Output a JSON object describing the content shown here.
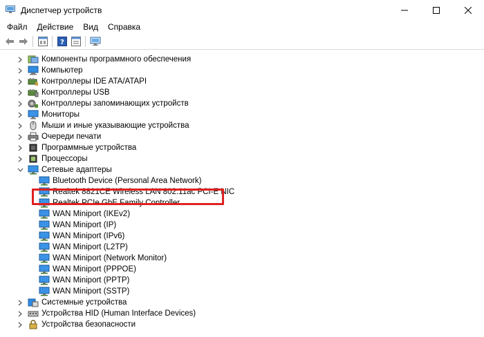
{
  "window": {
    "title": "Диспетчер устройств"
  },
  "menu": {
    "items": [
      {
        "label": "Файл"
      },
      {
        "label": "Действие"
      },
      {
        "label": "Вид"
      },
      {
        "label": "Справка"
      }
    ]
  },
  "toolbar": {
    "buttons": [
      "back-icon",
      "forward-icon",
      "properties-icon",
      "help-icon",
      "view-icon",
      "monitor-scan-icon"
    ]
  },
  "tree": {
    "categories_top": [
      {
        "label": "Компоненты программного обеспечения",
        "icon": "software-components-icon"
      },
      {
        "label": "Компьютер",
        "icon": "computer-icon"
      },
      {
        "label": "Контроллеры IDE ATA/ATAPI",
        "icon": "ide-controller-icon"
      },
      {
        "label": "Контроллеры USB",
        "icon": "usb-controller-icon"
      },
      {
        "label": "Контроллеры запоминающих устройств",
        "icon": "storage-controller-icon"
      },
      {
        "label": "Мониторы",
        "icon": "monitor-icon"
      },
      {
        "label": "Мыши и иные указывающие устройства",
        "icon": "mouse-icon"
      },
      {
        "label": "Очереди печати",
        "icon": "printer-icon"
      },
      {
        "label": "Программные устройства",
        "icon": "software-device-icon"
      },
      {
        "label": "Процессоры",
        "icon": "processor-icon"
      }
    ],
    "network": {
      "label": "Сетевые адаптеры",
      "icon": "network-adapter-icon",
      "children": [
        {
          "label": "Bluetooth Device (Personal Area Network)"
        },
        {
          "label": "Realtek 8821CE Wireless LAN 802.11ac PCI-E NIC"
        },
        {
          "label": "Realtek PCIe GbE Family Controller"
        },
        {
          "label": "WAN Miniport (IKEv2)"
        },
        {
          "label": "WAN Miniport (IP)"
        },
        {
          "label": "WAN Miniport (IPv6)"
        },
        {
          "label": "WAN Miniport (L2TP)"
        },
        {
          "label": "WAN Miniport (Network Monitor)"
        },
        {
          "label": "WAN Miniport (PPPOE)"
        },
        {
          "label": "WAN Miniport (PPTP)"
        },
        {
          "label": "WAN Miniport (SSTP)"
        }
      ]
    },
    "categories_bottom": [
      {
        "label": "Системные устройства",
        "icon": "system-device-icon"
      },
      {
        "label": "Устройства HID (Human Interface Devices)",
        "icon": "hid-icon"
      },
      {
        "label": "Устройства безопасности",
        "icon": "security-device-icon"
      }
    ]
  },
  "colors": {
    "highlight": "#e02020",
    "adapter_blue": "#2e7fd6"
  }
}
